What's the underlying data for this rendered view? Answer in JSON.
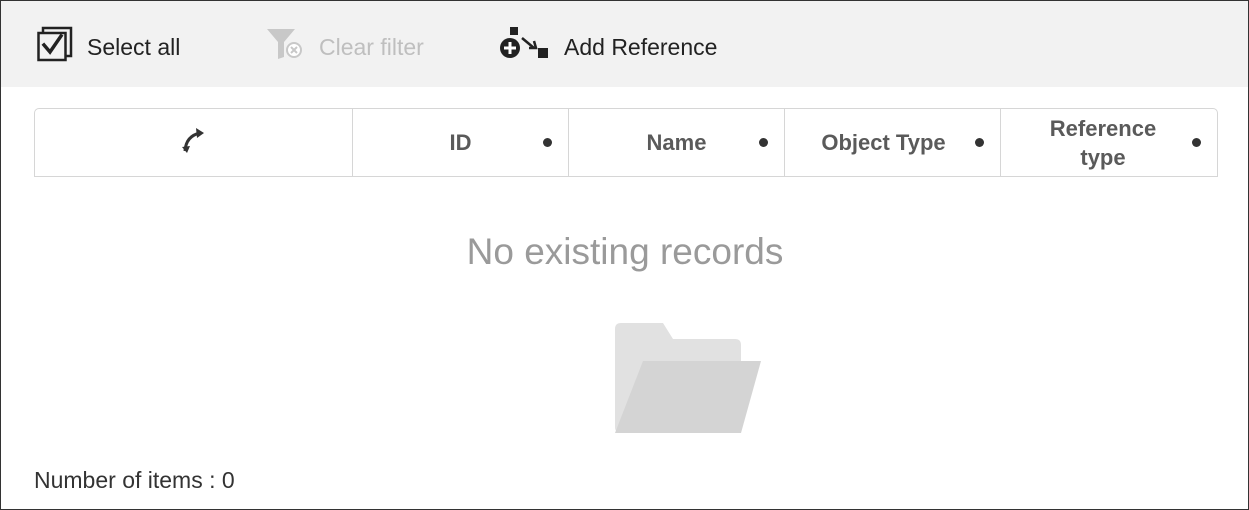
{
  "toolbar": {
    "select_all": {
      "label": "Select all",
      "icon": "select-all-checkbox-icon",
      "enabled": true
    },
    "clear_filter": {
      "label": "Clear filter",
      "icon": "clear-filter-icon",
      "enabled": false
    },
    "add_reference": {
      "label": "Add Reference",
      "icon": "add-reference-icon",
      "enabled": true
    }
  },
  "grid": {
    "columns": [
      {
        "label": "",
        "icon": "reference-direction-icon"
      },
      {
        "label": "ID"
      },
      {
        "label": "Name"
      },
      {
        "label": "Object Type"
      },
      {
        "label": "Reference type"
      }
    ],
    "empty_message": "No existing records",
    "empty_icon": "empty-folder-icon"
  },
  "footer": {
    "item_count": "Number of items : 0"
  },
  "colors": {
    "toolbar_bg": "#f2f2f2",
    "disabled_text": "#bfbfbf",
    "empty_text": "#9a9a9a"
  }
}
